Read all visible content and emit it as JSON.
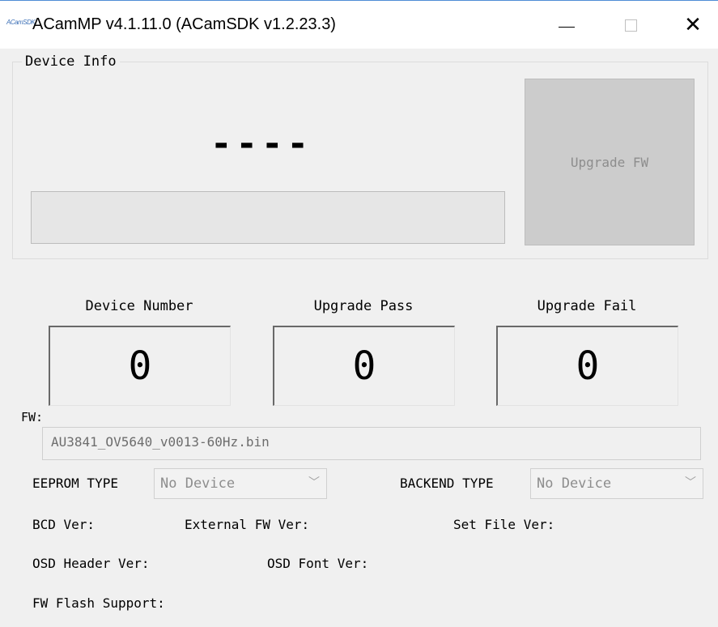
{
  "window": {
    "icon_text": "ACamSDK",
    "title": "ACamMP v4.1.11.0 (ACamSDK v1.2.23.3)"
  },
  "device_info": {
    "group_label": "Device Info",
    "status": "----",
    "progress": 0,
    "upgrade_button": "Upgrade FW"
  },
  "counters": {
    "device_number": {
      "label": "Device Number",
      "value": "0"
    },
    "upgrade_pass": {
      "label": "Upgrade Pass",
      "value": "0"
    },
    "upgrade_fail": {
      "label": "Upgrade Fail",
      "value": "0"
    }
  },
  "firmware": {
    "label": "FW:",
    "file": "AU3841_OV5640_v0013-60Hz.bin"
  },
  "eeprom": {
    "label": "EEPROM TYPE",
    "selected": "No Device"
  },
  "backend": {
    "label": "BACKEND TYPE",
    "selected": "No Device"
  },
  "versions": {
    "bcd": "BCD Ver:",
    "external_fw": "External FW Ver:",
    "set_file": "Set File Ver:",
    "osd_header": "OSD Header Ver:",
    "osd_font": "OSD Font Ver:",
    "fw_flash_support": "FW Flash Support:"
  }
}
